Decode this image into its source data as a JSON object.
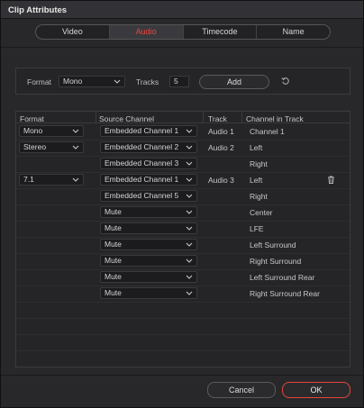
{
  "window": {
    "title": "Clip Attributes"
  },
  "tabs": [
    {
      "label": "Video",
      "active": false
    },
    {
      "label": "Audio",
      "active": true
    },
    {
      "label": "Timecode",
      "active": false
    },
    {
      "label": "Name",
      "active": false
    }
  ],
  "add_panel": {
    "format_label": "Format",
    "format_value": "Mono",
    "tracks_label": "Tracks",
    "tracks_value": "5",
    "add_label": "Add",
    "reset_icon": "reset-icon"
  },
  "grid": {
    "headers": {
      "format": "Format",
      "source": "Source Channel",
      "track": "Track",
      "channel": "Channel in Track"
    },
    "rows": [
      {
        "format": "Mono",
        "source": "Embedded Channel 1",
        "track": "Audio 1",
        "channel": "Channel 1",
        "trash": false
      },
      {
        "format": "Stereo",
        "source": "Embedded Channel 2",
        "track": "Audio 2",
        "channel": "Left",
        "trash": false
      },
      {
        "format": "",
        "source": "Embedded Channel 3",
        "track": "",
        "channel": "Right",
        "trash": false
      },
      {
        "format": "7.1",
        "source": "Embedded Channel 1",
        "track": "Audio 3",
        "channel": "Left",
        "trash": true
      },
      {
        "format": "",
        "source": "Embedded Channel 5",
        "track": "",
        "channel": "Right",
        "trash": false
      },
      {
        "format": "",
        "source": "Mute",
        "track": "",
        "channel": "Center",
        "trash": false
      },
      {
        "format": "",
        "source": "Mute",
        "track": "",
        "channel": "LFE",
        "trash": false
      },
      {
        "format": "",
        "source": "Mute",
        "track": "",
        "channel": "Left Surround",
        "trash": false
      },
      {
        "format": "",
        "source": "Mute",
        "track": "",
        "channel": "Right Surround",
        "trash": false
      },
      {
        "format": "",
        "source": "Mute",
        "track": "",
        "channel": "Left Surround Rear",
        "trash": false
      },
      {
        "format": "",
        "source": "Mute",
        "track": "",
        "channel": "Right Surround Rear",
        "trash": false
      }
    ]
  },
  "footer": {
    "cancel_label": "Cancel",
    "ok_label": "OK"
  },
  "colors": {
    "accent": "#e6453c",
    "background": "#28282b",
    "panel": "#252528"
  }
}
